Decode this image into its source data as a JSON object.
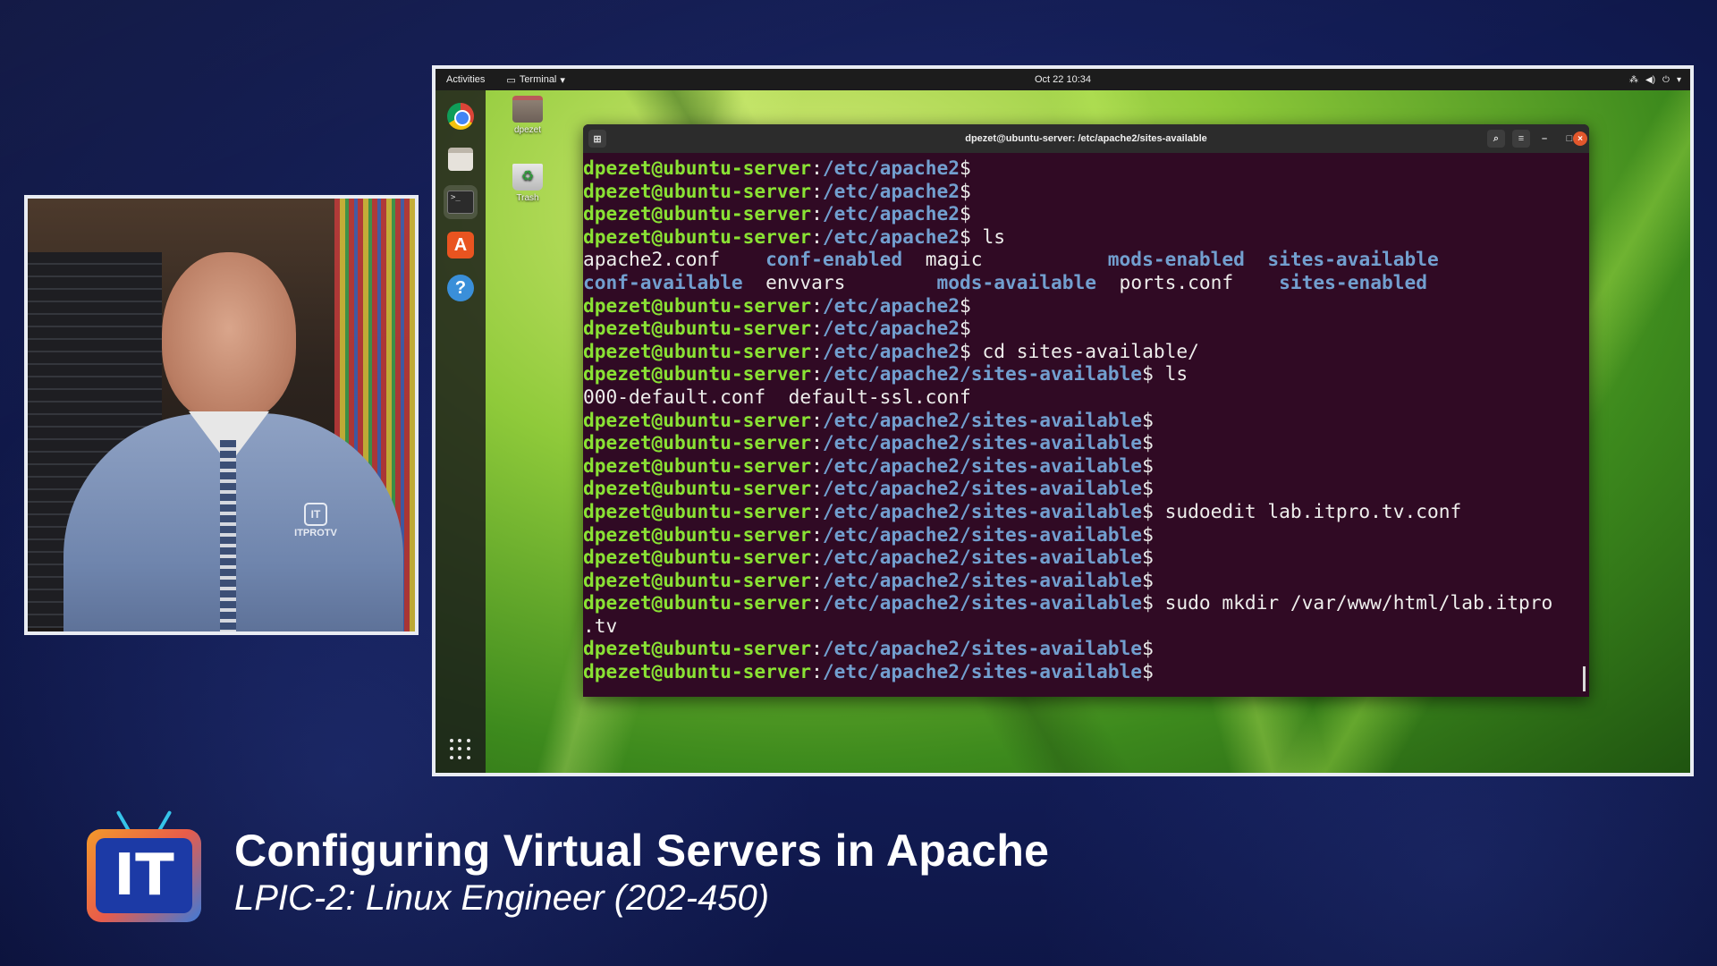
{
  "topbar": {
    "activities": "Activities",
    "app_menu": "Terminal",
    "clock": "Oct 22  10:34"
  },
  "desktop_icons": {
    "home_label": "dpezet",
    "trash_label": "Trash"
  },
  "terminal": {
    "title": "dpezet@ubuntu-server: /etc/apache2/sites-available",
    "lines": [
      {
        "user": "dpezet@ubuntu-server",
        "sep": ":",
        "path": "/etc/apache2",
        "cmd": "$"
      },
      {
        "user": "dpezet@ubuntu-server",
        "sep": ":",
        "path": "/etc/apache2",
        "cmd": "$"
      },
      {
        "user": "dpezet@ubuntu-server",
        "sep": ":",
        "path": "/etc/apache2",
        "cmd": "$"
      },
      {
        "user": "dpezet@ubuntu-server",
        "sep": ":",
        "path": "/etc/apache2",
        "cmd": "$ ls"
      },
      {
        "ls": [
          {
            "t": "apache2.conf    ",
            "d": false
          },
          {
            "t": "conf-enabled",
            "d": true
          },
          {
            "t": "  magic           ",
            "d": false
          },
          {
            "t": "mods-enabled",
            "d": true
          },
          {
            "t": "  ",
            "d": false
          },
          {
            "t": "sites-available",
            "d": true
          }
        ]
      },
      {
        "ls": [
          {
            "t": "conf-available",
            "d": true
          },
          {
            "t": "  envvars        ",
            "d": false
          },
          {
            "t": "mods-available",
            "d": true
          },
          {
            "t": "  ports.conf    ",
            "d": false
          },
          {
            "t": "sites-enabled",
            "d": true
          }
        ]
      },
      {
        "user": "dpezet@ubuntu-server",
        "sep": ":",
        "path": "/etc/apache2",
        "cmd": "$"
      },
      {
        "user": "dpezet@ubuntu-server",
        "sep": ":",
        "path": "/etc/apache2",
        "cmd": "$"
      },
      {
        "user": "dpezet@ubuntu-server",
        "sep": ":",
        "path": "/etc/apache2",
        "cmd": "$ cd sites-available/"
      },
      {
        "user": "dpezet@ubuntu-server",
        "sep": ":",
        "path": "/etc/apache2/sites-available",
        "cmd": "$ ls"
      },
      {
        "plain": "000-default.conf  default-ssl.conf"
      },
      {
        "user": "dpezet@ubuntu-server",
        "sep": ":",
        "path": "/etc/apache2/sites-available",
        "cmd": "$"
      },
      {
        "user": "dpezet@ubuntu-server",
        "sep": ":",
        "path": "/etc/apache2/sites-available",
        "cmd": "$"
      },
      {
        "user": "dpezet@ubuntu-server",
        "sep": ":",
        "path": "/etc/apache2/sites-available",
        "cmd": "$"
      },
      {
        "user": "dpezet@ubuntu-server",
        "sep": ":",
        "path": "/etc/apache2/sites-available",
        "cmd": "$"
      },
      {
        "user": "dpezet@ubuntu-server",
        "sep": ":",
        "path": "/etc/apache2/sites-available",
        "cmd": "$ sudoedit lab.itpro.tv.conf"
      },
      {
        "user": "dpezet@ubuntu-server",
        "sep": ":",
        "path": "/etc/apache2/sites-available",
        "cmd": "$"
      },
      {
        "user": "dpezet@ubuntu-server",
        "sep": ":",
        "path": "/etc/apache2/sites-available",
        "cmd": "$"
      },
      {
        "user": "dpezet@ubuntu-server",
        "sep": ":",
        "path": "/etc/apache2/sites-available",
        "cmd": "$"
      },
      {
        "user": "dpezet@ubuntu-server",
        "sep": ":",
        "path": "/etc/apache2/sites-available",
        "cmd": "$ sudo mkdir /var/www/html/lab.itpro"
      },
      {
        "plain": ".tv"
      },
      {
        "user": "dpezet@ubuntu-server",
        "sep": ":",
        "path": "/etc/apache2/sites-available",
        "cmd": "$"
      },
      {
        "user": "dpezet@ubuntu-server",
        "sep": ":",
        "path": "/etc/apache2/sites-available",
        "cmd": "$"
      }
    ]
  },
  "webcam": {
    "shirt_logo": "ITPROTV",
    "shirt_badge": "IT"
  },
  "lower_third": {
    "logo_text": "IT",
    "title": "Configuring Virtual Servers in Apache",
    "subtitle": "LPIC-2: Linux Engineer (202-450)"
  },
  "colors": {
    "terminal_bg": "#300a24",
    "prompt_user": "#8ae234",
    "prompt_path": "#729fcf",
    "page_bg": "#121c55"
  }
}
